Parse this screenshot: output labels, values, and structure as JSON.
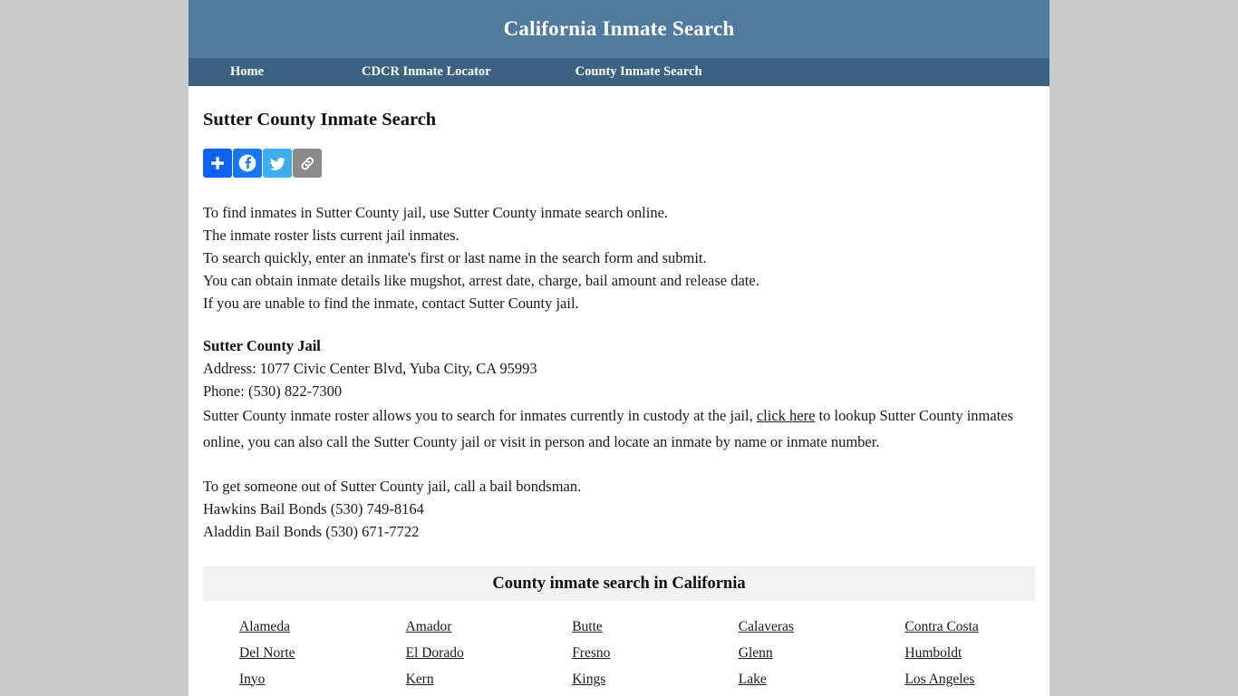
{
  "site": {
    "title": "California Inmate Search",
    "header_bg": "#517a9f",
    "nav_bg": "#3c6282",
    "page_bg": "#cccccc"
  },
  "nav": {
    "items": [
      {
        "label": "Home"
      },
      {
        "label": "CDCR Inmate Locator"
      },
      {
        "label": "County Inmate Search"
      }
    ]
  },
  "main": {
    "page_title": "Sutter County Inmate Search",
    "share": {
      "buttons": [
        {
          "name": "addthis-share-icon",
          "label": "Share",
          "color": "#0f61f0"
        },
        {
          "name": "facebook-icon",
          "label": "Facebook",
          "color": "#1877f2"
        },
        {
          "name": "twitter-icon",
          "label": "Twitter",
          "color": "#3eaced"
        },
        {
          "name": "copy-link-icon",
          "label": "Copy Link",
          "color": "#8b8b8b"
        }
      ]
    },
    "intro_lines": [
      "To find inmates in Sutter County jail, use Sutter County inmate search online.",
      "The inmate roster lists current jail inmates.",
      "To search quickly, enter an inmate's first or last name in the search form and submit.",
      "You can obtain inmate details like mugshot, arrest date, charge, bail amount and release date.",
      "If you are unable to find the inmate, contact Sutter County jail."
    ],
    "jail": {
      "name": "Sutter County Jail",
      "address": "Address: 1077 Civic Center Blvd, Yuba City, CA 95993",
      "phone": "Phone: (530) 822-7300"
    },
    "roster_paragraph": {
      "before_link": "Sutter County inmate roster allows you to search for inmates currently in custody at the jail, ",
      "link_text": "click here",
      "after_link": " to lookup Sutter County inmates online, you can also call the Sutter County jail or visit in person and locate an inmate by name or inmate number."
    },
    "bail": {
      "intro": "To get someone out of Sutter County jail, call a bail bondsman.",
      "bondsmen": [
        "Hawkins Bail Bonds (530) 749-8164",
        "Aladdin Bail Bonds (530) 671-7722"
      ]
    },
    "county_section": {
      "heading": "County inmate search in California",
      "counties": [
        "Alameda",
        "Amador",
        "Butte",
        "Calaveras",
        "Contra Costa",
        "Del Norte",
        "El Dorado",
        "Fresno",
        "Glenn",
        "Humboldt",
        "Inyo",
        "Kern",
        "Kings",
        "Lake",
        "Los Angeles"
      ]
    }
  }
}
